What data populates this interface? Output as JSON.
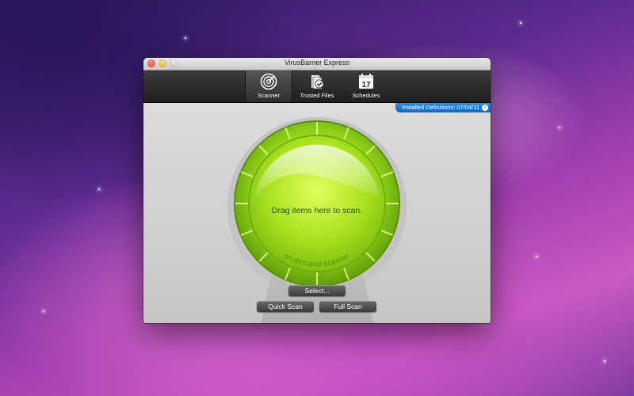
{
  "window": {
    "title": "VirusBarrier Express"
  },
  "toolbar": {
    "items": [
      {
        "label": "Scanner",
        "icon": "radar-icon"
      },
      {
        "label": "Trusted Files",
        "icon": "trusted-files-icon"
      },
      {
        "label": "Schedules",
        "icon": "calendar-icon"
      }
    ],
    "calendar_day": "17"
  },
  "definitions": {
    "label": "Installed Definitions: 07/04/11",
    "icon": "arrow-right-circle-icon"
  },
  "scanner": {
    "drop_text": "Drag items here to scan.",
    "ring_text": "on-demand scanner",
    "accent": "#9ee01e"
  },
  "buttons": {
    "select": "Select...",
    "quick_scan": "Quick Scan",
    "full_scan": "Full Scan"
  }
}
